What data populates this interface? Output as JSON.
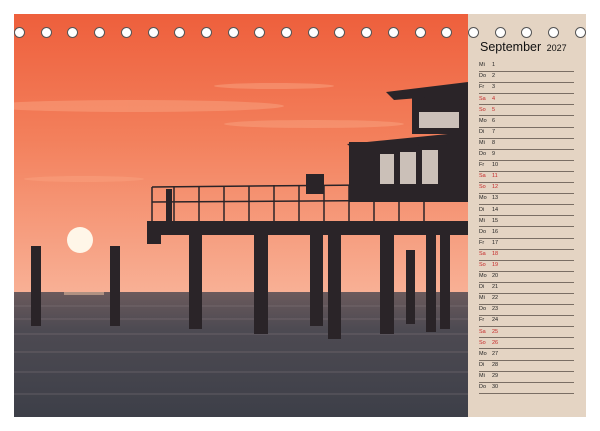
{
  "calendar": {
    "month": "September",
    "year": "2027",
    "days": [
      {
        "wd": "Mi",
        "d": "1",
        "we": false
      },
      {
        "wd": "Do",
        "d": "2",
        "we": false
      },
      {
        "wd": "Fr",
        "d": "3",
        "we": false
      },
      {
        "wd": "Sa",
        "d": "4",
        "we": true
      },
      {
        "wd": "So",
        "d": "5",
        "we": true
      },
      {
        "wd": "Mo",
        "d": "6",
        "we": false
      },
      {
        "wd": "Di",
        "d": "7",
        "we": false
      },
      {
        "wd": "Mi",
        "d": "8",
        "we": false
      },
      {
        "wd": "Do",
        "d": "9",
        "we": false
      },
      {
        "wd": "Fr",
        "d": "10",
        "we": false
      },
      {
        "wd": "Sa",
        "d": "11",
        "we": true
      },
      {
        "wd": "So",
        "d": "12",
        "we": true
      },
      {
        "wd": "Mo",
        "d": "13",
        "we": false
      },
      {
        "wd": "Di",
        "d": "14",
        "we": false
      },
      {
        "wd": "Mi",
        "d": "15",
        "we": false
      },
      {
        "wd": "Do",
        "d": "16",
        "we": false
      },
      {
        "wd": "Fr",
        "d": "17",
        "we": false
      },
      {
        "wd": "Sa",
        "d": "18",
        "we": true
      },
      {
        "wd": "So",
        "d": "19",
        "we": true
      },
      {
        "wd": "Mo",
        "d": "20",
        "we": false
      },
      {
        "wd": "Di",
        "d": "21",
        "we": false
      },
      {
        "wd": "Mi",
        "d": "22",
        "we": false
      },
      {
        "wd": "Do",
        "d": "23",
        "we": false
      },
      {
        "wd": "Fr",
        "d": "24",
        "we": false
      },
      {
        "wd": "Sa",
        "d": "25",
        "we": true
      },
      {
        "wd": "So",
        "d": "26",
        "we": true
      },
      {
        "wd": "Mo",
        "d": "27",
        "we": false
      },
      {
        "wd": "Di",
        "d": "28",
        "we": false
      },
      {
        "wd": "Mi",
        "d": "29",
        "we": false
      },
      {
        "wd": "Do",
        "d": "30",
        "we": false
      }
    ]
  },
  "binding": {
    "ring_count": 22
  },
  "colors": {
    "sky_top": "#f06a45",
    "sky_bottom": "#f7a584",
    "sea": "#4a4850",
    "sidebar": "#e4d4c3",
    "weekend": "#c62828"
  }
}
